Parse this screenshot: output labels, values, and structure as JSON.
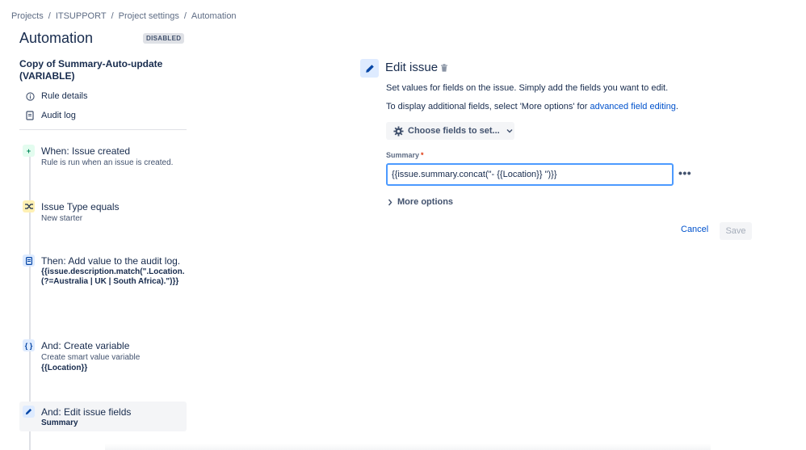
{
  "breadcrumb": [
    "Projects",
    "ITSUPPORT",
    "Project settings",
    "Automation"
  ],
  "page": {
    "title": "Automation",
    "status_badge": "DISABLED"
  },
  "rule": {
    "name": "Copy of Summary-Auto-update (VARIABLE)"
  },
  "sidebar_links": [
    {
      "label": "Rule details",
      "icon": "info-icon"
    },
    {
      "label": "Audit log",
      "icon": "document-icon"
    }
  ],
  "steps": [
    {
      "title": "When: Issue created",
      "subtitle": "Rule is run when an issue is created.",
      "code": "",
      "icon": "plus-icon"
    },
    {
      "title": "Issue Type equals",
      "subtitle": "New starter",
      "code": "",
      "icon": "shuffle-icon"
    },
    {
      "title": "Then: Add value to the audit log.",
      "subtitle": "",
      "code": "{{issue.description.match(\".Location.(?=Australia | UK | South Africa).\")}}",
      "icon": "document-icon"
    },
    {
      "title": "And: Create variable",
      "subtitle": "Create smart value variable",
      "code": "{{Location}}",
      "icon": "braces-icon"
    },
    {
      "title": "And: Edit issue fields",
      "subtitle": "",
      "code": "Summary",
      "icon": "pencil-icon"
    }
  ],
  "panel": {
    "title": "Edit issue",
    "description": "Set values for fields on the issue. Simply add the fields you want to edit.",
    "additional_prefix": "To display additional fields, select 'More options' for ",
    "additional_link": "advanced field editing",
    "additional_suffix": ".",
    "choose_fields_label": "Choose fields to set...",
    "field_label": "Summary",
    "required_marker": "*",
    "field_value": "{{issue.summary.concat(\"- {{Location}} \")}}",
    "more_options_label": "More options",
    "cancel_label": "Cancel",
    "save_label": "Save"
  },
  "colors": {
    "accent": "#0052cc",
    "focus_border": "#4c9aff",
    "required": "#de350b"
  }
}
